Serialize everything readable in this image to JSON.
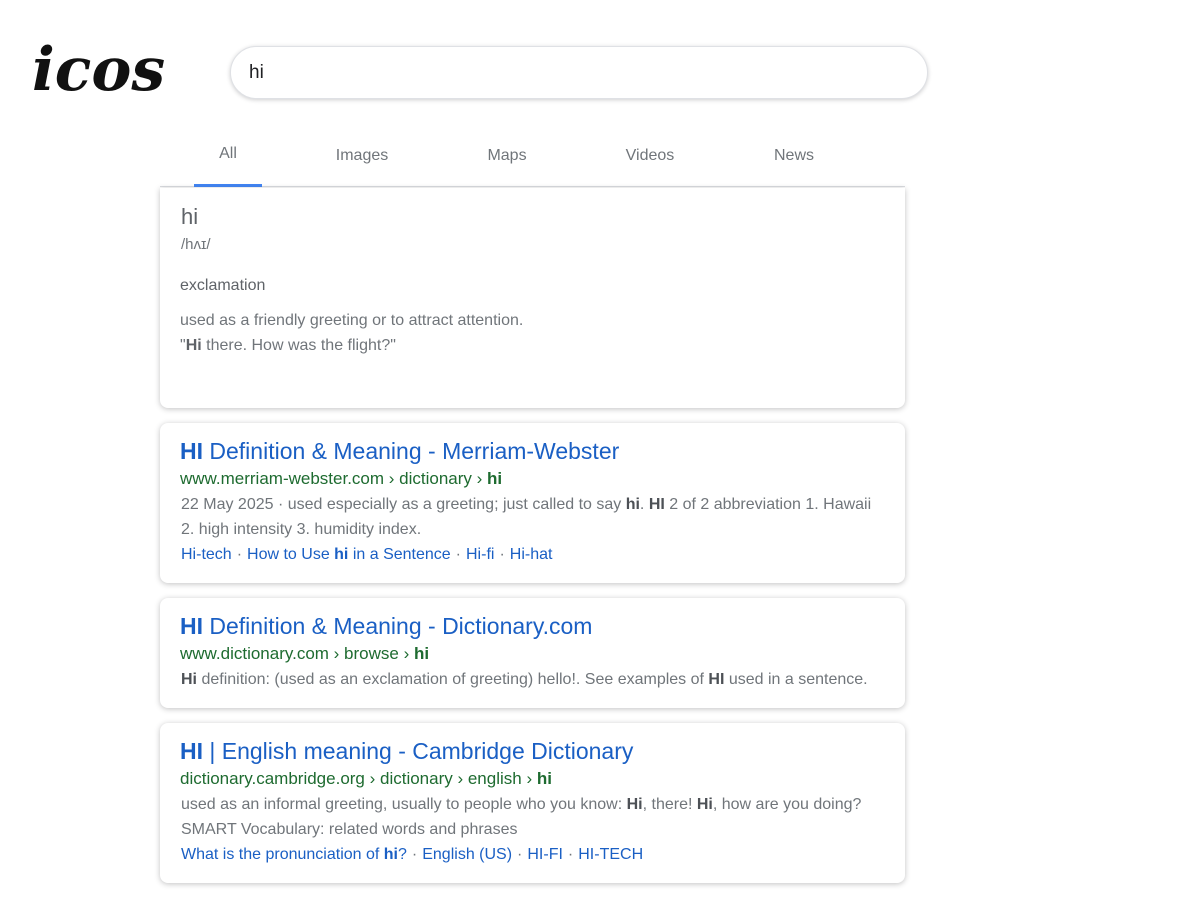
{
  "logo": {
    "text": "icos"
  },
  "search": {
    "value": "hi"
  },
  "tabs": [
    {
      "label": "All",
      "active": true
    },
    {
      "label": "Images",
      "active": false
    },
    {
      "label": "Maps",
      "active": false
    },
    {
      "label": "Videos",
      "active": false
    },
    {
      "label": "News",
      "active": false
    }
  ],
  "dictionary": {
    "word": "hi",
    "pronunciation": "/hʌɪ/",
    "part_of_speech": "exclamation",
    "definition": "used as a friendly greeting or to attract attention.",
    "example_quote_open": "\"",
    "example_bold": "Hi",
    "example_rest": " there. How was the flight?\""
  },
  "results": [
    {
      "title_bold": "HI",
      "title_rest": " Definition & Meaning - Merriam-Webster",
      "url_prefix": "www.merriam-webster.com › dictionary › ",
      "url_bold": "hi",
      "snippet_line1_a": "22 May 2025 · used especially as a greeting; just called to say ",
      "snippet_line1_b": "hi",
      "snippet_line1_c": ". ",
      "snippet_line1_d": "HI",
      "snippet_line1_e": " 2 of 2 abbreviation 1. Hawaii",
      "snippet_line2": "2. high intensity 3. humidity index.",
      "sublinks": {
        "hitech": "Hi-tech",
        "howto_a": "How to Use ",
        "howto_b": "hi",
        "howto_c": " in a Sentence",
        "hifi": "Hi-fi",
        "hihat": "Hi-hat"
      }
    },
    {
      "title_bold": "HI",
      "title_rest": " Definition & Meaning - Dictionary.com",
      "url_prefix": "www.dictionary.com › browse › ",
      "url_bold": "hi",
      "snippet_a": "Hi",
      "snippet_b": " definition: (used as an exclamation of greeting) hello!. See examples of ",
      "snippet_c": "HI",
      "snippet_d": " used in a sentence."
    },
    {
      "title_bold": "HI",
      "title_rest": " | English meaning - Cambridge Dictionary",
      "url_prefix": "dictionary.cambridge.org › dictionary › english › ",
      "url_bold": "hi",
      "snippet_line1_a": "used as an informal greeting, usually to people who you know: ",
      "snippet_line1_b": "Hi",
      "snippet_line1_c": ", there! ",
      "snippet_line1_d": "Hi",
      "snippet_line1_e": ", how are you doing?",
      "snippet_line2": "SMART Vocabulary: related words and phrases",
      "sublinks": {
        "pron_a": "What is the pronunciation of ",
        "pron_b": "hi",
        "pron_c": "?",
        "english_us": "English (US)",
        "hifi": "HI-FI",
        "hitech": "HI-TECH"
      }
    }
  ],
  "separator": "·"
}
